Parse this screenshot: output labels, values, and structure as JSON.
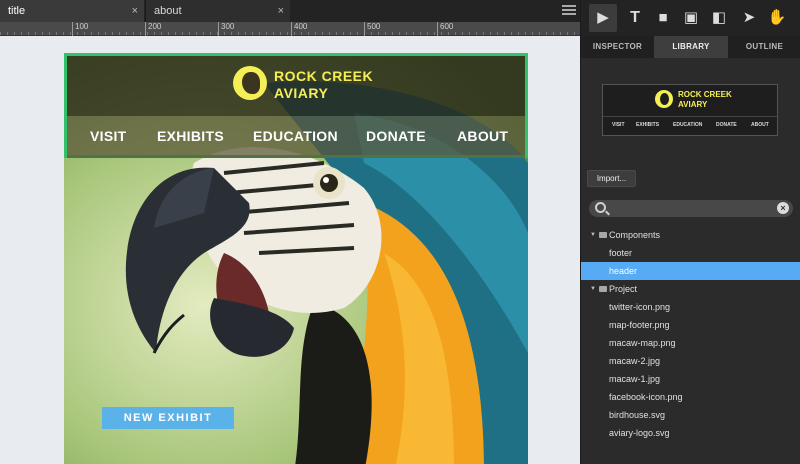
{
  "tabs": [
    {
      "label": "title",
      "close": "×"
    },
    {
      "label": "about",
      "close": "×"
    }
  ],
  "ruler": {
    "labels": [
      "100",
      "200",
      "300",
      "400",
      "500",
      "600"
    ]
  },
  "site": {
    "logo_line1": "ROCK CREEK",
    "logo_line2": "AVIARY",
    "nav": [
      "VISIT",
      "EXHIBITS",
      "EDUCATION",
      "DONATE",
      "ABOUT"
    ],
    "cta": "NEW EXHIBIT",
    "colors": {
      "logo": "#f4ef55",
      "selection": "#33c26b",
      "cta": "#5ab2e8"
    }
  },
  "toolbar": {
    "tools": [
      "pointer-icon",
      "text-icon",
      "rectangle-icon",
      "text-box-icon",
      "panel-icon",
      "arrow-icon",
      "hand-icon"
    ]
  },
  "panel_tabs": [
    "INSPECTOR",
    "LIBRARY",
    "OUTLINE"
  ],
  "preview": {
    "line1": "ROCK CREEK",
    "line2": "AVIARY",
    "nav": [
      "VISIT",
      "EXHIBITS",
      "EDUCATION",
      "DONATE",
      "ABOUT"
    ]
  },
  "library": {
    "import_label": "Import...",
    "search_placeholder": "",
    "clear": "×",
    "folders": [
      {
        "name": "Components",
        "items": [
          "footer",
          "header"
        ]
      },
      {
        "name": "Project",
        "items": [
          "twitter-icon.png",
          "map-footer.png",
          "macaw-map.png",
          "macaw-2.jpg",
          "macaw-1.jpg",
          "facebook-icon.png",
          "birdhouse.svg",
          "aviary-logo.svg"
        ]
      }
    ],
    "selected_item": "header",
    "selection_color": "#57aaf4"
  }
}
